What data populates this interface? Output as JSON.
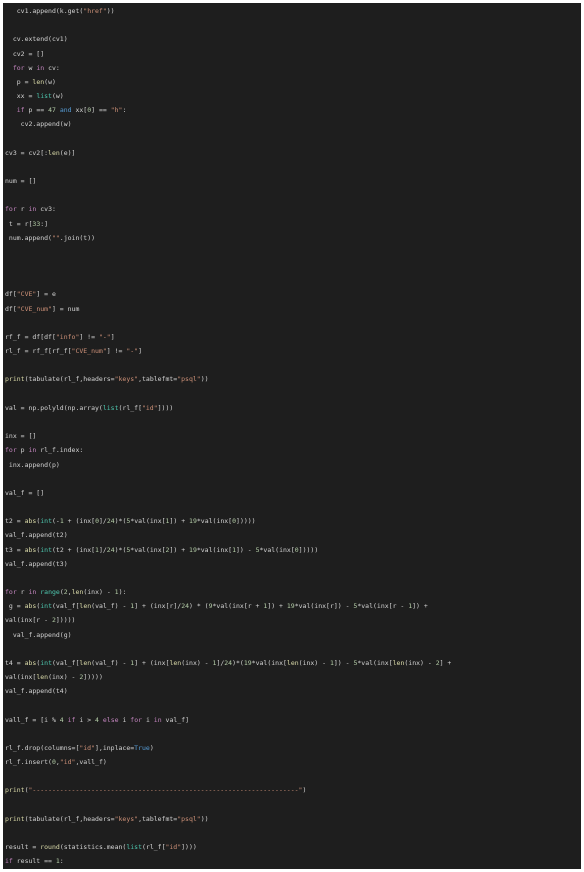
{
  "colors": {
    "background": "#1e1e1e",
    "keyword": "#c586c0",
    "function": "#dcdcaa",
    "string": "#ce9178",
    "number": "#b5cea8",
    "builtin": "#4ec9b0",
    "plain": "#d4d4d4"
  },
  "code_lines": [
    [
      [
        "p",
        "   cv1.append(k.get("
      ],
      [
        "s",
        "\"href\""
      ],
      [
        "p",
        "))"
      ]
    ],
    [],
    [
      [
        "p",
        "  cv.extend(cv1)"
      ]
    ],
    [
      [
        "p",
        "  cv2 = []"
      ]
    ],
    [
      [
        "p",
        "  "
      ],
      [
        "k",
        "for"
      ],
      [
        "p",
        " w "
      ],
      [
        "k",
        "in"
      ],
      [
        "p",
        " cv:"
      ]
    ],
    [
      [
        "p",
        "   p = "
      ],
      [
        "f",
        "len"
      ],
      [
        "p",
        "(w)"
      ]
    ],
    [
      [
        "p",
        "   xx = "
      ],
      [
        "b",
        "list"
      ],
      [
        "p",
        "(w)"
      ]
    ],
    [
      [
        "p",
        "   "
      ],
      [
        "k",
        "if"
      ],
      [
        "p",
        " p == "
      ],
      [
        "n",
        "47"
      ],
      [
        "p",
        " "
      ],
      [
        "o",
        "and"
      ],
      [
        "p",
        " xx["
      ],
      [
        "n",
        "0"
      ],
      [
        "p",
        "] == "
      ],
      [
        "s",
        "\"h\""
      ],
      [
        "p",
        ":"
      ]
    ],
    [
      [
        "p",
        "    cv2.append(w)"
      ]
    ],
    [],
    [
      [
        "p",
        "cv3 = cv2[:"
      ],
      [
        "f",
        "len"
      ],
      [
        "p",
        "(e)]"
      ]
    ],
    [],
    [
      [
        "p",
        "num = []"
      ]
    ],
    [],
    [
      [
        "k",
        "for"
      ],
      [
        "p",
        " r "
      ],
      [
        "k",
        "in"
      ],
      [
        "p",
        " cv3:"
      ]
    ],
    [
      [
        "p",
        " t = r["
      ],
      [
        "n",
        "33"
      ],
      [
        "p",
        ":]"
      ]
    ],
    [
      [
        "p",
        " num.append("
      ],
      [
        "s",
        "\"\""
      ],
      [
        "p",
        ".join(t))"
      ]
    ],
    [],
    [],
    [],
    [
      [
        "p",
        "df["
      ],
      [
        "s",
        "\"CVE\""
      ],
      [
        "p",
        "] = e"
      ]
    ],
    [
      [
        "p",
        "df["
      ],
      [
        "s",
        "\"CVE_num\""
      ],
      [
        "p",
        "] = num"
      ]
    ],
    [],
    [
      [
        "p",
        "rf_f = df[df["
      ],
      [
        "s",
        "\"info\""
      ],
      [
        "p",
        "] != "
      ],
      [
        "s",
        "\"-\""
      ],
      [
        "p",
        "]"
      ]
    ],
    [
      [
        "p",
        "rl_f = rf_f[rf_f["
      ],
      [
        "s",
        "\"CVE_num\""
      ],
      [
        "p",
        "] != "
      ],
      [
        "s",
        "\"-\""
      ],
      [
        "p",
        "]"
      ]
    ],
    [],
    [
      [
        "f",
        "print"
      ],
      [
        "p",
        "(tabulate(rl_f,headers="
      ],
      [
        "s",
        "\"keys\""
      ],
      [
        "p",
        ",tablefmt="
      ],
      [
        "s",
        "\"psql\""
      ],
      [
        "p",
        "))"
      ]
    ],
    [],
    [
      [
        "p",
        "val = np.polyld(np.array("
      ],
      [
        "b",
        "list"
      ],
      [
        "p",
        "(rl_f["
      ],
      [
        "s",
        "\"id\""
      ],
      [
        "p",
        "])))"
      ]
    ],
    [],
    [
      [
        "p",
        "inx = []"
      ]
    ],
    [
      [
        "k",
        "for"
      ],
      [
        "p",
        " p "
      ],
      [
        "k",
        "in"
      ],
      [
        "p",
        " rl_f.index:"
      ]
    ],
    [
      [
        "p",
        " inx.append(p)"
      ]
    ],
    [],
    [
      [
        "p",
        "val_f = []"
      ]
    ],
    [],
    [
      [
        "p",
        "t2 = "
      ],
      [
        "f",
        "abs"
      ],
      [
        "p",
        "("
      ],
      [
        "b",
        "int"
      ],
      [
        "p",
        "(-"
      ],
      [
        "n",
        "1"
      ],
      [
        "p",
        " + (inx["
      ],
      [
        "n",
        "0"
      ],
      [
        "p",
        "]/"
      ],
      [
        "n",
        "24"
      ],
      [
        "p",
        ")*("
      ],
      [
        "n",
        "5"
      ],
      [
        "p",
        "*val(inx["
      ],
      [
        "n",
        "1"
      ],
      [
        "p",
        "]) + "
      ],
      [
        "n",
        "19"
      ],
      [
        "p",
        "*val(inx["
      ],
      [
        "n",
        "0"
      ],
      [
        "p",
        "]))))"
      ]
    ],
    [
      [
        "p",
        "val_f.append(t2)"
      ]
    ],
    [
      [
        "p",
        "t3 = "
      ],
      [
        "f",
        "abs"
      ],
      [
        "p",
        "("
      ],
      [
        "b",
        "int"
      ],
      [
        "p",
        "(t2 + (inx["
      ],
      [
        "n",
        "1"
      ],
      [
        "p",
        "]/"
      ],
      [
        "n",
        "24"
      ],
      [
        "p",
        ")*("
      ],
      [
        "n",
        "5"
      ],
      [
        "p",
        "*val(inx["
      ],
      [
        "n",
        "2"
      ],
      [
        "p",
        "]) + "
      ],
      [
        "n",
        "19"
      ],
      [
        "p",
        "*val(inx["
      ],
      [
        "n",
        "1"
      ],
      [
        "p",
        "]) - "
      ],
      [
        "n",
        "5"
      ],
      [
        "p",
        "*val(inx["
      ],
      [
        "n",
        "0"
      ],
      [
        "p",
        "]))))"
      ]
    ],
    [
      [
        "p",
        "val_f.append(t3)"
      ]
    ],
    [],
    [
      [
        "k",
        "for"
      ],
      [
        "p",
        " r "
      ],
      [
        "k",
        "in"
      ],
      [
        "p",
        " "
      ],
      [
        "b",
        "range"
      ],
      [
        "p",
        "("
      ],
      [
        "n",
        "2"
      ],
      [
        "p",
        ","
      ],
      [
        "f",
        "len"
      ],
      [
        "p",
        "(inx) - "
      ],
      [
        "n",
        "1"
      ],
      [
        "p",
        "):"
      ]
    ],
    [
      [
        "p",
        " g = "
      ],
      [
        "f",
        "abs"
      ],
      [
        "p",
        "("
      ],
      [
        "b",
        "int"
      ],
      [
        "p",
        "(val_f["
      ],
      [
        "f",
        "len"
      ],
      [
        "p",
        "(val_f) - "
      ],
      [
        "n",
        "1"
      ],
      [
        "p",
        "] + (inx[r]/"
      ],
      [
        "n",
        "24"
      ],
      [
        "p",
        ") * ("
      ],
      [
        "n",
        "9"
      ],
      [
        "p",
        "*val(inx[r + "
      ],
      [
        "n",
        "1"
      ],
      [
        "p",
        "]) + "
      ],
      [
        "n",
        "19"
      ],
      [
        "p",
        "*val(inx[r]) - "
      ],
      [
        "n",
        "5"
      ],
      [
        "p",
        "*val(inx[r - "
      ],
      [
        "n",
        "1"
      ],
      [
        "p",
        "]) +"
      ]
    ],
    [
      [
        "p",
        "val(inx[r - "
      ],
      [
        "n",
        "2"
      ],
      [
        "p",
        "]))))"
      ]
    ],
    [
      [
        "p",
        "  val_f.append(g)"
      ]
    ],
    [],
    [
      [
        "p",
        "t4 = "
      ],
      [
        "f",
        "abs"
      ],
      [
        "p",
        "("
      ],
      [
        "b",
        "int"
      ],
      [
        "p",
        "(val_f["
      ],
      [
        "f",
        "len"
      ],
      [
        "p",
        "(val_f) - "
      ],
      [
        "n",
        "1"
      ],
      [
        "p",
        "] + (inx["
      ],
      [
        "f",
        "len"
      ],
      [
        "p",
        "(inx) - "
      ],
      [
        "n",
        "1"
      ],
      [
        "p",
        "]/"
      ],
      [
        "n",
        "24"
      ],
      [
        "p",
        ")*("
      ],
      [
        "n",
        "19"
      ],
      [
        "p",
        "*val(inx["
      ],
      [
        "f",
        "len"
      ],
      [
        "p",
        "(inx) - "
      ],
      [
        "n",
        "1"
      ],
      [
        "p",
        "]) - "
      ],
      [
        "n",
        "5"
      ],
      [
        "p",
        "*val(inx["
      ],
      [
        "f",
        "len"
      ],
      [
        "p",
        "(inx) - "
      ],
      [
        "n",
        "2"
      ],
      [
        "p",
        "] +"
      ]
    ],
    [
      [
        "p",
        "val(inx["
      ],
      [
        "f",
        "len"
      ],
      [
        "p",
        "(inx) - "
      ],
      [
        "n",
        "2"
      ],
      [
        "p",
        "]))))"
      ]
    ],
    [
      [
        "p",
        "val_f.append(t4)"
      ]
    ],
    [],
    [
      [
        "p",
        "vall_f = [i % "
      ],
      [
        "n",
        "4"
      ],
      [
        "p",
        " "
      ],
      [
        "k",
        "if"
      ],
      [
        "p",
        " i > "
      ],
      [
        "n",
        "4"
      ],
      [
        "p",
        " "
      ],
      [
        "k",
        "else"
      ],
      [
        "p",
        " i "
      ],
      [
        "k",
        "for"
      ],
      [
        "p",
        " i "
      ],
      [
        "k",
        "in"
      ],
      [
        "p",
        " val_f]"
      ]
    ],
    [],
    [
      [
        "p",
        "rl_f.drop(columns=["
      ],
      [
        "s",
        "\"id\""
      ],
      [
        "p",
        "],inplace="
      ],
      [
        "o",
        "True"
      ],
      [
        "p",
        ")"
      ]
    ],
    [
      [
        "p",
        "rl_f.insert("
      ],
      [
        "n",
        "0"
      ],
      [
        "p",
        ","
      ],
      [
        "s",
        "\"id\""
      ],
      [
        "p",
        ",vall_f)"
      ]
    ],
    [],
    [
      [
        "f",
        "print"
      ],
      [
        "p",
        "("
      ],
      [
        "s",
        "\"--------------------------------------------------------------------\""
      ],
      [
        "p",
        ")"
      ]
    ],
    [],
    [
      [
        "f",
        "print"
      ],
      [
        "p",
        "(tabulate(rl_f,headers="
      ],
      [
        "s",
        "\"keys\""
      ],
      [
        "p",
        ",tablefmt="
      ],
      [
        "s",
        "\"psql\""
      ],
      [
        "p",
        "))"
      ]
    ],
    [],
    [
      [
        "p",
        "result = "
      ],
      [
        "f",
        "round"
      ],
      [
        "p",
        "(statistics.mean("
      ],
      [
        "b",
        "list"
      ],
      [
        "p",
        "(rl_f["
      ],
      [
        "s",
        "\"id\""
      ],
      [
        "p",
        "])))"
      ]
    ],
    [
      [
        "k",
        "if"
      ],
      [
        "p",
        " result == "
      ],
      [
        "n",
        "1"
      ],
      [
        "p",
        ":"
      ]
    ]
  ]
}
